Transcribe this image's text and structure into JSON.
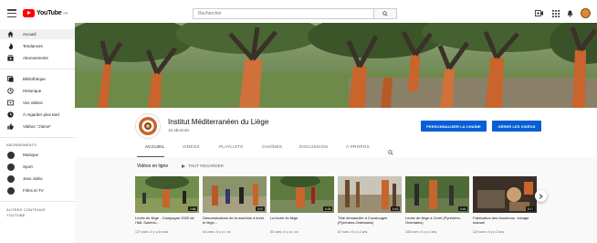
{
  "topbar": {
    "logo_text": "YouTube",
    "logo_country": "FR",
    "search_placeholder": "Rechercher"
  },
  "sidebar": {
    "main": [
      {
        "label": "Accueil",
        "icon": "home-icon"
      },
      {
        "label": "Tendances",
        "icon": "trending-icon"
      },
      {
        "label": "Abonnements",
        "icon": "subscriptions-icon"
      }
    ],
    "library": [
      {
        "label": "Bibliothèque",
        "icon": "library-icon"
      },
      {
        "label": "Historique",
        "icon": "history-icon"
      },
      {
        "label": "Vos vidéos",
        "icon": "your-videos-icon"
      },
      {
        "label": "À regarder plus tard",
        "icon": "watch-later-icon"
      },
      {
        "label": "Vidéos \"J'aime\"",
        "icon": "liked-videos-icon"
      }
    ],
    "subscriptions_heading": "ABONNEMENTS",
    "subscriptions": [
      {
        "label": "Musique"
      },
      {
        "label": "Sport"
      },
      {
        "label": "Jeux vidéo"
      },
      {
        "label": "Films et TV"
      }
    ],
    "other_heading_line1": "AUTRES CONTENUS",
    "other_heading_line2": "YOUTUBE"
  },
  "channel": {
    "name": "Institut Méditerranéen du Liège",
    "subscribers": "15 abonnés",
    "customize_label": "PERSONNALISER LA CHAÎNE",
    "manage_label": "GÉRER LES VIDÉOS"
  },
  "tabs": [
    "ACCUEIL",
    "VIDÉOS",
    "PLAYLISTS",
    "CHAÎNES",
    "DISCUSSION",
    "À PROPOS"
  ],
  "section": {
    "title": "Vidéos en ligne",
    "play_all": "TOUT REGARDER"
  },
  "videos": [
    {
      "title": "Levée de liège - Campagne 2020 de l'IML Subério...",
      "duration": "2:58",
      "meta": "127 vues • Il y a 8 mois"
    },
    {
      "title": "Démonstrations de la machine à lever le liège...",
      "duration": "3:07",
      "meta": "64 vues • Il y a 1 an"
    },
    {
      "title": "La levée du liège",
      "duration": "0:28",
      "meta": "60 vues • Il y a 1 an"
    },
    {
      "title": "Tête démasclée à Coustouges (Pyrénées-Orientales)",
      "duration": "0:43",
      "meta": "87 vues • Il y a 2 ans"
    },
    {
      "title": "Levée de liège à Ceret (Pyrénées-Orientales)",
      "duration": "0:44",
      "meta": "165 vues • Il y a 2 ans"
    },
    {
      "title": "Fabrication des bouchons : tubage manuel",
      "duration": "0:17",
      "meta": "115 vues • Il y a 2 ans"
    }
  ],
  "colors": {
    "accent": "#065fd4",
    "brand_red": "#ff0000",
    "cork_orange": "#c8642c"
  }
}
